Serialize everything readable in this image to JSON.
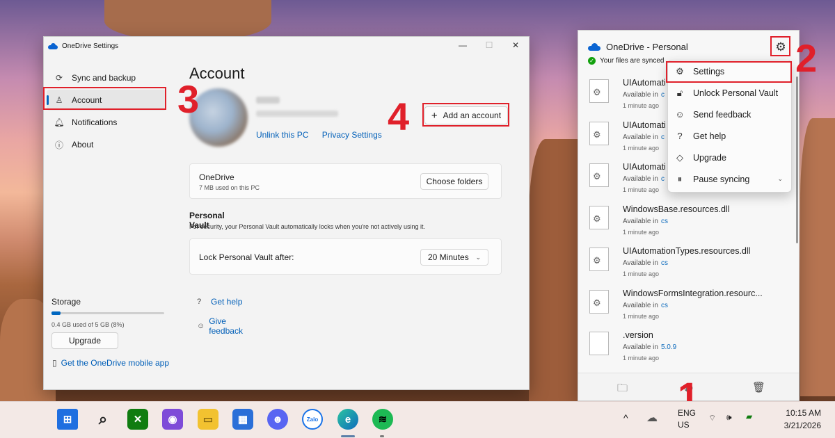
{
  "settings_window": {
    "title": "OneDrive Settings",
    "controls": {
      "minimize": "—",
      "maximize": "☐",
      "close": "✕"
    },
    "nav": [
      {
        "label": "Sync and backup",
        "icon": "sync-icon"
      },
      {
        "label": "Account",
        "icon": "person-icon"
      },
      {
        "label": "Notifications",
        "icon": "bell-icon"
      },
      {
        "label": "About",
        "icon": "info-icon"
      }
    ],
    "storage": {
      "title": "Storage",
      "used_text": "0.4 GB used of 5 GB (8%)",
      "used_fraction": 0.08,
      "upgrade_label": "Upgrade"
    },
    "mobile_app_link": "Get the OneDrive mobile app",
    "page_title": "Account",
    "account_links": {
      "unlink": "Unlink this PC",
      "privacy": "Privacy Settings"
    },
    "add_account": {
      "icon": "+",
      "label": "Add an account"
    },
    "onedrive_card": {
      "title": "OneDrive",
      "usage": "7 MB used on this PC",
      "button": "Choose folders"
    },
    "personal_vault": {
      "title": "Personal Vault",
      "description": "For security, your Personal Vault automatically locks when you're not actively using it.",
      "lock_label": "Lock Personal Vault after:",
      "lock_value": "20 Minutes"
    },
    "help_links": {
      "help": "Get help",
      "feedback": "Give feedback"
    }
  },
  "annotations": {
    "n1": "1",
    "n2": "2",
    "n3": "3",
    "n4": "4",
    "color": "#e0202a"
  },
  "flyout": {
    "title": "OneDrive - Personal",
    "sync_status": "Your files are synced",
    "menu": [
      {
        "label": "Settings",
        "icon": "gear-icon"
      },
      {
        "label": "Unlock Personal Vault",
        "icon": "lock-icon"
      },
      {
        "label": "Send feedback",
        "icon": "feedback-icon"
      },
      {
        "label": "Get help",
        "icon": "help-icon"
      },
      {
        "label": "Upgrade",
        "icon": "diamond-icon"
      },
      {
        "label": "Pause syncing",
        "icon": "pause-icon"
      }
    ],
    "files": [
      {
        "name": "UIAutomati",
        "status": "Available in",
        "location": "c",
        "time": "1 minute ago"
      },
      {
        "name": "UIAutomati",
        "status": "Available in",
        "location": "c",
        "time": "1 minute ago"
      },
      {
        "name": "UIAutomati",
        "status": "Available in",
        "location": "c",
        "time": "1 minute ago"
      },
      {
        "name": "WindowsBase.resources.dll",
        "status": "Available in",
        "location": "cs",
        "time": "1 minute ago"
      },
      {
        "name": "UIAutomationTypes.resources.dll",
        "status": "Available in",
        "location": "cs",
        "time": "1 minute ago"
      },
      {
        "name": "WindowsFormsIntegration.resourc...",
        "status": "Available in",
        "location": "cs",
        "time": "1 minute ago"
      },
      {
        "name": ".version",
        "status": "Available in",
        "location": "5.0.9",
        "time": "1 minute ago"
      }
    ]
  },
  "taskbar": {
    "apps": [
      "start-icon",
      "search-icon",
      "xbox-icon",
      "clipchamp-icon",
      "file-explorer-icon",
      "microsoft-store-icon",
      "discord-icon",
      "zalo-icon",
      "edge-icon",
      "spotify-icon"
    ],
    "zalo_text": "Zalo",
    "language_line1": "ENG",
    "language_line2": "US",
    "time": "10:15 AM",
    "date": "3/21/2026"
  }
}
